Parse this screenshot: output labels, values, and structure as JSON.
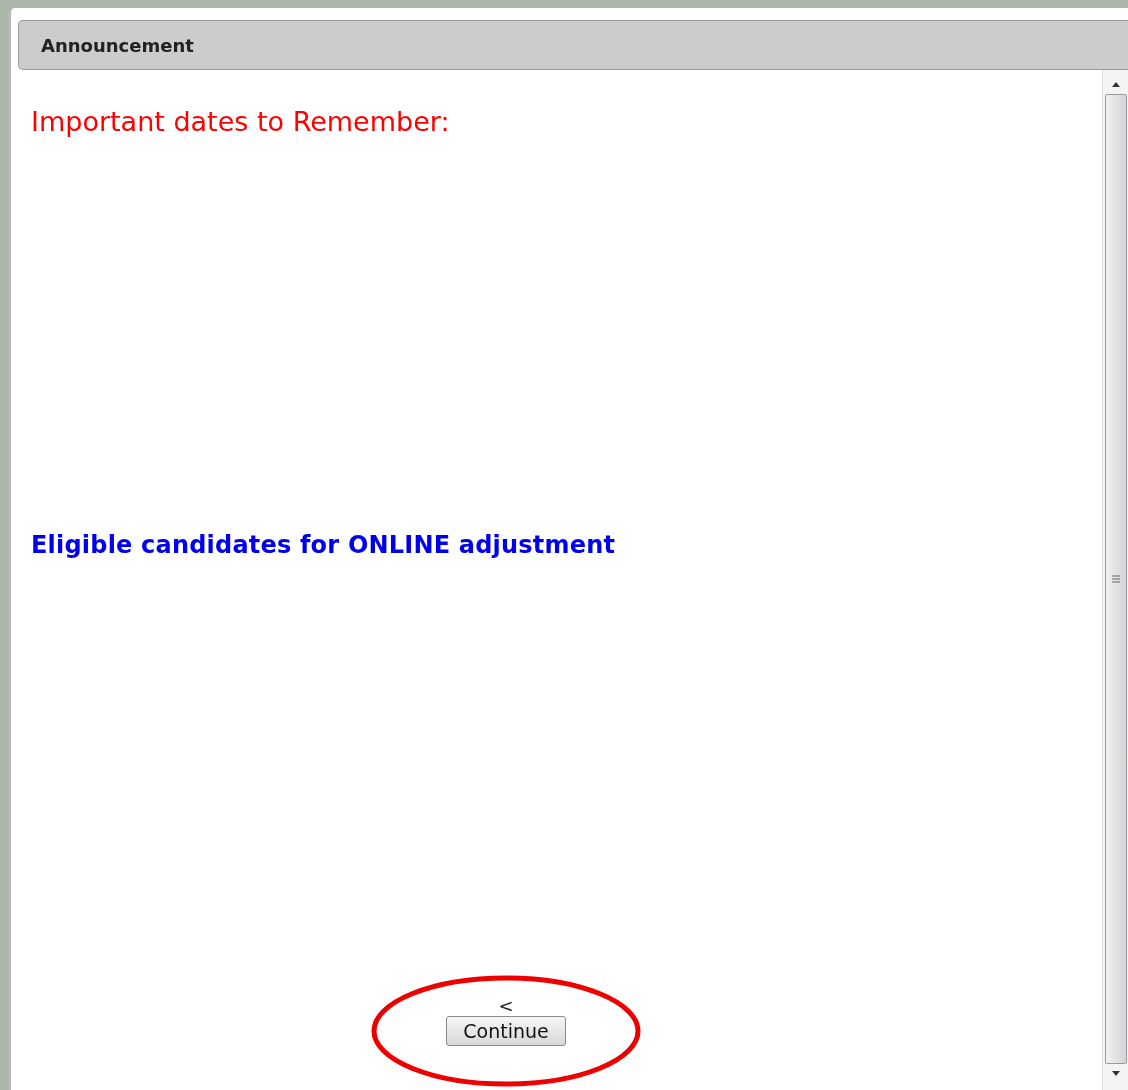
{
  "dialog": {
    "title": "Announcement"
  },
  "content": {
    "heading": "Important dates to Remember:",
    "subheading": "Eligible candidates for ONLINE adjustment",
    "marker": "<"
  },
  "buttons": [
    {
      "label": "Continue",
      "highlighted": true
    }
  ]
}
